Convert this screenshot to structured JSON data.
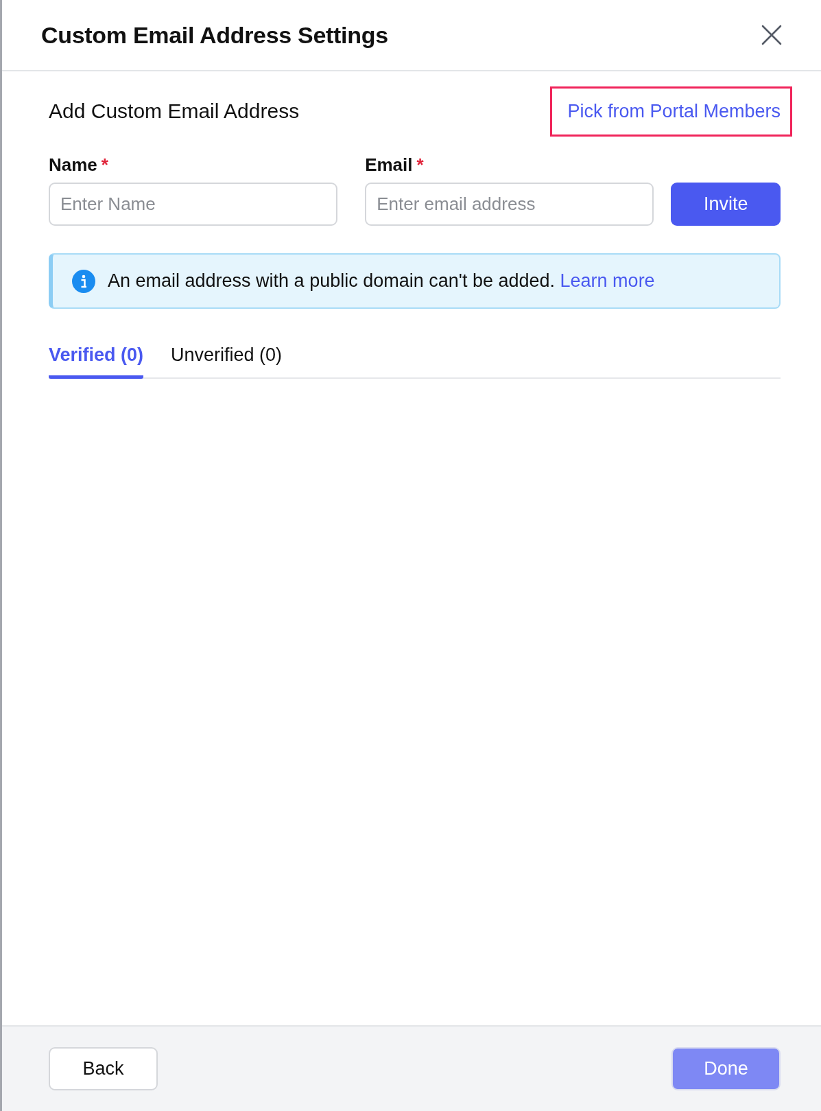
{
  "dialog": {
    "title": "Custom Email Address Settings"
  },
  "section": {
    "title": "Add Custom Email Address",
    "link": "Pick from Portal Members",
    "highlighted": true
  },
  "fields": [
    {
      "label": "Name",
      "required": "*",
      "placeholder": "Enter Name"
    },
    {
      "label": "Email",
      "required": "*",
      "placeholder": "Enter email address"
    }
  ],
  "invite_button": "Invite",
  "notice": {
    "text": "An email address with a public domain can't be added.",
    "link": "Learn more"
  },
  "tabs": [
    {
      "label": "Verified (0)",
      "selected": true
    },
    {
      "label": "Unverified (0)",
      "selected": false
    }
  ],
  "footer": {
    "back": "Back",
    "done": {
      "label": "Done",
      "disabled": true
    }
  }
}
